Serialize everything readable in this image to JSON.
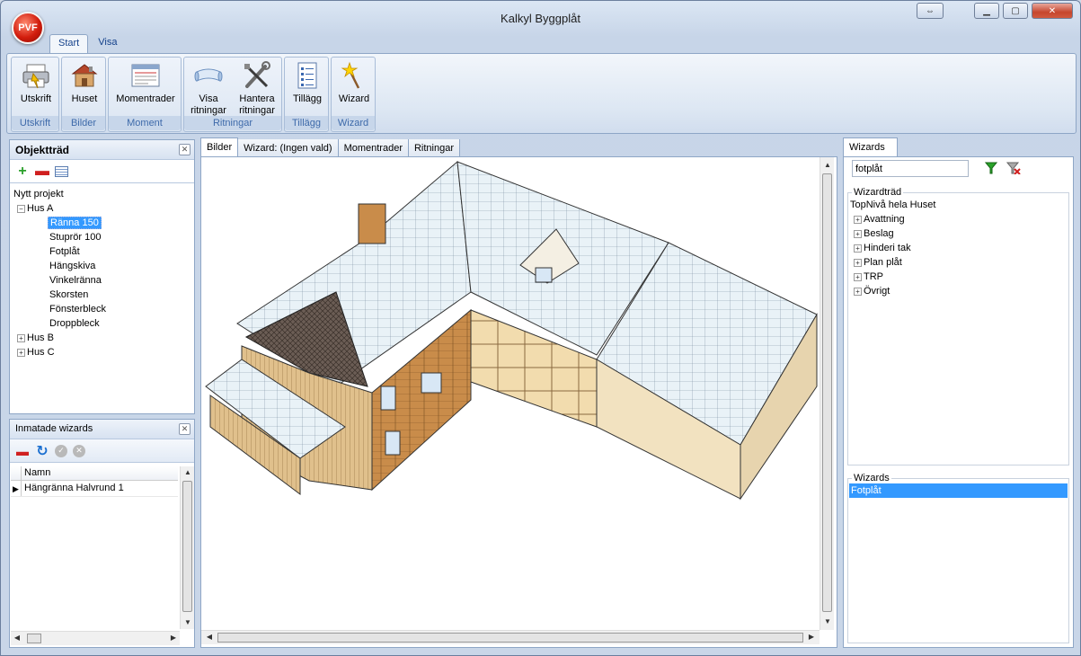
{
  "window": {
    "title": "Kalkyl Byggplåt",
    "logo": "PVF"
  },
  "ribbon": {
    "tabs": [
      "Start",
      "Visa"
    ],
    "groups": [
      {
        "label": "Utskrift",
        "buttons": [
          {
            "label": "Utskrift",
            "icon": "printer-icon"
          }
        ]
      },
      {
        "label": "Bilder",
        "buttons": [
          {
            "label": "Huset",
            "icon": "house-icon"
          }
        ]
      },
      {
        "label": "Moment",
        "buttons": [
          {
            "label": "Momentrader",
            "icon": "table-window-icon"
          }
        ]
      },
      {
        "label": "Ritningar",
        "buttons": [
          {
            "label": "Visa",
            "label2": "ritningar",
            "icon": "drawing-scroll-icon"
          },
          {
            "label": "Hantera",
            "label2": "ritningar",
            "icon": "tools-icon"
          }
        ]
      },
      {
        "label": "Tillägg",
        "buttons": [
          {
            "label": "Tillägg",
            "icon": "document-list-icon"
          }
        ]
      },
      {
        "label": "Wizard",
        "buttons": [
          {
            "label": "Wizard",
            "icon": "magic-wand-icon"
          }
        ]
      }
    ]
  },
  "object_tree": {
    "title": "Objektträd",
    "root": "Nytt projekt",
    "houses": [
      {
        "label": "Hus A",
        "expanded": true,
        "children": [
          "Ränna 150",
          "Stuprör 100",
          "Fotplåt",
          "Hängskiva",
          "Vinkelränna",
          "Skorsten",
          "Fönsterbleck",
          "Droppbleck"
        ]
      },
      {
        "label": "Hus B",
        "expanded": false
      },
      {
        "label": "Hus C",
        "expanded": false
      }
    ],
    "selected": "Ränna 150"
  },
  "entered_wizards": {
    "title": "Inmatade wizards",
    "column": "Namn",
    "rows": [
      "Hängränna Halvrund 1"
    ]
  },
  "doc_tabs": [
    "Bilder",
    "Wizard: (Ingen vald)",
    "Momentrader",
    "Ritningar"
  ],
  "wizards_panel": {
    "tab": "Wizards",
    "search_value": "fotplåt",
    "tree_legend": "Wizardträd",
    "tree_root": "TopNivå hela Huset",
    "tree_items": [
      "Avattning",
      "Beslag",
      "Hinderi tak",
      "Plan plåt",
      "TRP",
      "Övrigt"
    ],
    "list_legend": "Wizards",
    "list_items": [
      "Fotplåt"
    ]
  },
  "colors": {
    "selection": "#3399ff",
    "ribbon_text": "#15428b",
    "group_label": "#3e6aaa"
  }
}
